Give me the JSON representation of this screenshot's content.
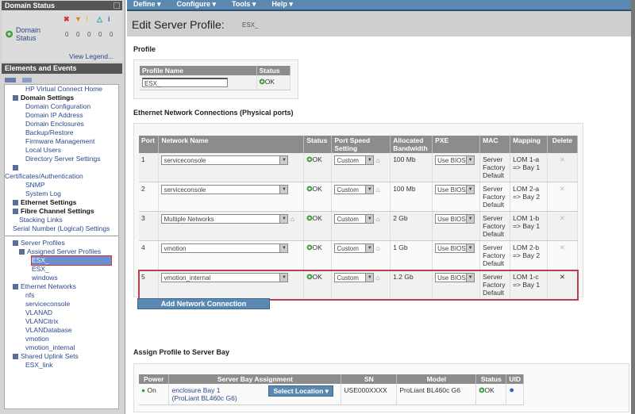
{
  "left": {
    "domain_status": {
      "title": "Domain Status",
      "label": "Domain Status",
      "severities": [
        {
          "icon": "critical-icon",
          "glyph": "✖",
          "color": "#d03030",
          "count": "0"
        },
        {
          "icon": "major-icon",
          "glyph": "▼",
          "color": "#e08020",
          "count": "0"
        },
        {
          "icon": "minor-icon",
          "glyph": "!",
          "color": "#e0c020",
          "count": "0"
        },
        {
          "icon": "warning-icon",
          "glyph": "△",
          "color": "#30a0a0",
          "count": "0"
        },
        {
          "icon": "info-icon",
          "glyph": "i",
          "color": "#3070c0",
          "count": "0"
        }
      ],
      "view_legend": "View Legend..."
    },
    "elements_title": "Elements and Events",
    "tree": [
      {
        "label": "HP Virtual Connect Home",
        "lvl": 3,
        "type": "link"
      },
      {
        "label": "Domain Settings",
        "lvl": 1,
        "type": "bold"
      },
      {
        "label": "Domain Configuration",
        "lvl": 3,
        "type": "link"
      },
      {
        "label": "Domain IP Address",
        "lvl": 3,
        "type": "link"
      },
      {
        "label": "Domain Enclosures",
        "lvl": 3,
        "type": "link"
      },
      {
        "label": "Backup/Restore",
        "lvl": 3,
        "type": "link"
      },
      {
        "label": "Firmware Management",
        "lvl": 3,
        "type": "link"
      },
      {
        "label": "Local Users",
        "lvl": 3,
        "type": "link"
      },
      {
        "label": "",
        "lvl": 3,
        "type": "link"
      },
      {
        "label": "Directory Server Settings",
        "lvl": 3,
        "type": "link"
      },
      {
        "label": "",
        "lvl": 1,
        "type": "square"
      },
      {
        "label": "Certificates/Authentication",
        "lvl": 0,
        "type": "link"
      },
      {
        "label": "SNMP",
        "lvl": 3,
        "type": "link"
      },
      {
        "label": "System Log",
        "lvl": 3,
        "type": "link"
      },
      {
        "label": "Ethernet Settings",
        "lvl": 1,
        "type": "bold"
      },
      {
        "label": "Fibre Channel Settings",
        "lvl": 1,
        "type": "bold"
      },
      {
        "label": "Stacking Links",
        "lvl": 2,
        "type": "link"
      },
      {
        "label": "",
        "lvl": 2,
        "type": "link"
      },
      {
        "label": "Serial Number (Logical) Settings",
        "lvl": 1,
        "type": "link"
      },
      {
        "label": "",
        "lvl": 1,
        "type": "divider"
      },
      {
        "label": "Server Profiles",
        "lvl": 1,
        "type": "folder"
      },
      {
        "label": "Assigned Server Profiles",
        "lvl": 2,
        "type": "folder"
      },
      {
        "label": "ESX_",
        "lvl": 4,
        "type": "selected"
      },
      {
        "label": "ESX_",
        "lvl": 4,
        "type": "link"
      },
      {
        "label": "windows",
        "lvl": 4,
        "type": "link"
      },
      {
        "label": "Ethernet Networks",
        "lvl": 1,
        "type": "folder"
      },
      {
        "label": "nfs",
        "lvl": 3,
        "type": "link"
      },
      {
        "label": "serviceconsole",
        "lvl": 3,
        "type": "link"
      },
      {
        "label": "VLANAD",
        "lvl": 3,
        "type": "link"
      },
      {
        "label": "VLANCitrix",
        "lvl": 3,
        "type": "link"
      },
      {
        "label": "VLANDatabase",
        "lvl": 3,
        "type": "link"
      },
      {
        "label": "vmotion",
        "lvl": 3,
        "type": "link"
      },
      {
        "label": "vmotion_internal",
        "lvl": 3,
        "type": "link"
      },
      {
        "label": "Shared Uplink Sets",
        "lvl": 1,
        "type": "folder"
      },
      {
        "label": "ESX_link",
        "lvl": 3,
        "type": "link"
      }
    ]
  },
  "menu": [
    "Define ▾",
    "Configure ▾",
    "Tools ▾",
    "Help ▾"
  ],
  "title": "Edit Server Profile:",
  "title_name": "ESX_",
  "profile": {
    "section": "Profile",
    "headers": [
      "Profile Name",
      "Status"
    ],
    "name_value": "ESX_",
    "status": "OK"
  },
  "ethernet": {
    "section": "Ethernet Network Connections (Physical ports)",
    "headers": [
      "Port",
      "Network Name",
      "Status",
      "Port Speed Setting",
      "Allocated Bandwidth",
      "PXE",
      "MAC",
      "Mapping",
      "Delete"
    ],
    "rows": [
      {
        "port": "1",
        "network": "serviceconsole",
        "status": "OK",
        "speed": "Custom",
        "bw": "100 Mb",
        "pxe": "Use BIOS",
        "mac": "Server Factory Default",
        "mapping": "LOM 1-a => Bay 1",
        "multi": false
      },
      {
        "port": "2",
        "network": "serviceconsole",
        "status": "OK",
        "speed": "Custom",
        "bw": "100 Mb",
        "pxe": "Use BIOS",
        "mac": "Server Factory Default",
        "mapping": "LOM 2-a => Bay 2",
        "multi": false
      },
      {
        "port": "3",
        "network": "Multiple Networks",
        "status": "OK",
        "speed": "Custom",
        "bw": "2 Gb",
        "pxe": "Use BIOS",
        "mac": "Server Factory Default",
        "mapping": "LOM 1-b => Bay 1",
        "multi": true
      },
      {
        "port": "4",
        "network": "vmotion",
        "status": "OK",
        "speed": "Custom",
        "bw": "1 Gb",
        "pxe": "Use BIOS",
        "mac": "Server Factory Default",
        "mapping": "LOM 2-b => Bay 2",
        "multi": false
      },
      {
        "port": "5",
        "network": "vmotion_internal",
        "status": "OK",
        "speed": "Custom",
        "bw": "1.2 Gb",
        "pxe": "Use BIOS",
        "mac": "Server Factory Default",
        "mapping": "LOM 1-c => Bay 1",
        "multi": false
      }
    ],
    "delete_glyph": "✕",
    "add_button": "Add Network Connection"
  },
  "assign": {
    "section": "Assign Profile to Server Bay",
    "headers": [
      "Power",
      "Server Bay Assignment",
      "SN",
      "Model",
      "Status",
      "UID"
    ],
    "row": {
      "power": "On",
      "bay": "enclosure Bay 1",
      "bay_model": "(ProLiant BL460c G6)",
      "select": "Select Location ▾",
      "sn": "USE000XXXX",
      "model": "ProLiant BL460c G6",
      "status": "OK"
    }
  },
  "colors": {
    "menu": "#5b88b0",
    "header": "#8c8c8c",
    "highlight": "#b84050",
    "ok": "#3a9a3a"
  }
}
